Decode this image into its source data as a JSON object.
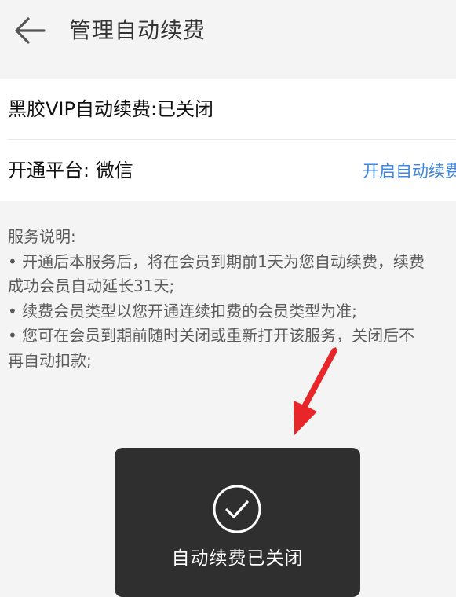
{
  "header": {
    "back_icon": "arrow-left-icon",
    "title": "管理自动续费"
  },
  "subscription": {
    "status_label": "黑胶VIP自动续费:已关闭",
    "platform_label": "开通平台: 微信",
    "enable_action": "开启自动续费"
  },
  "service_description": {
    "heading": "服务说明:",
    "lines": [
      "• 开通后本服务后，将在会员到期前1天为您自动续费，续费",
      "成功会员自动延长31天;",
      "• 续费会员类型以您开通连续扣费的会员类型为准;",
      "• 您可在会员到期前随时关闭或重新打开该服务，关闭后不",
      "再自动扣款;"
    ]
  },
  "annotation": {
    "arrow_icon": "red-arrow-icon",
    "arrow_color": "#e8262a"
  },
  "toast": {
    "icon": "check-circle-icon",
    "message": "自动续费已关闭"
  },
  "colors": {
    "background": "#f4f4f4",
    "link": "#3f86e0",
    "toast_background": "#2f2f2f"
  }
}
